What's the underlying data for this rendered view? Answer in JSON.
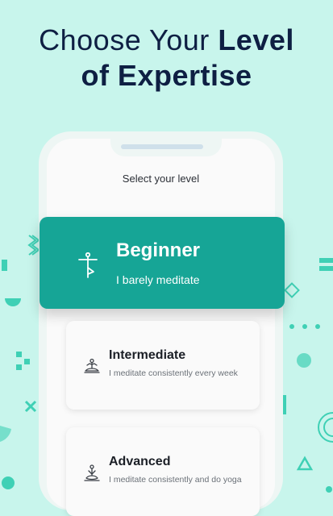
{
  "header": {
    "line1_light": "Choose Your ",
    "line1_bold": "Level",
    "line2_bold": "of Expertise"
  },
  "screen": {
    "select_label": "Select your level"
  },
  "levels": [
    {
      "title": "Beginner",
      "subtitle": "I barely meditate",
      "icon": "tree-pose-icon",
      "selected": true
    },
    {
      "title": "Intermediate",
      "subtitle": "I meditate consistently every week",
      "icon": "meditation-pose-icon",
      "selected": false
    },
    {
      "title": "Advanced",
      "subtitle": "I meditate consistently and do yoga",
      "icon": "lotus-pose-icon",
      "selected": false
    }
  ],
  "colors": {
    "background": "#c8f5ec",
    "accent": "#16a596",
    "headline": "#0e1f43",
    "decor": "#3fd0b5"
  }
}
